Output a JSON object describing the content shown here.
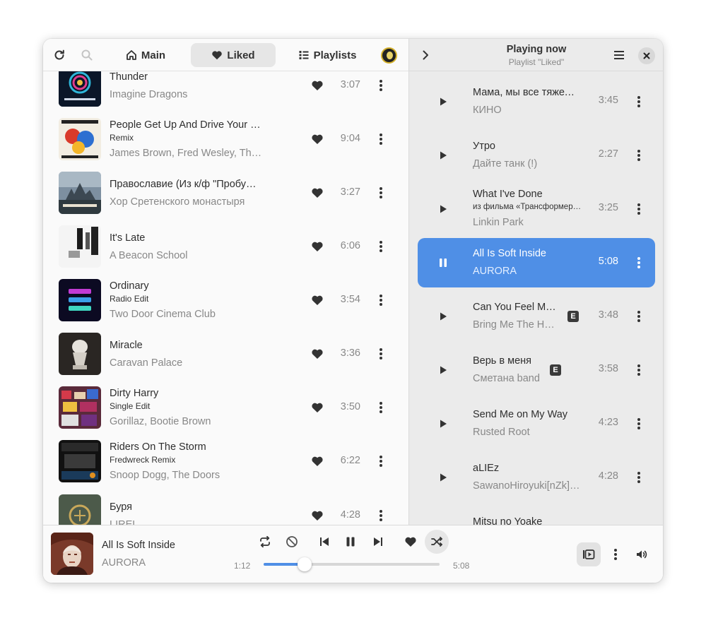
{
  "tabs": {
    "main": "Main",
    "liked": "Liked",
    "playlists": "Playlists"
  },
  "library": [
    {
      "title": "Thunder",
      "subtitle": "",
      "artist": "Imagine Dragons",
      "duration": "3:07"
    },
    {
      "title": "People Get Up And Drive Your …",
      "subtitle": "Remix",
      "artist": "James Brown, Fred Wesley, Th…",
      "duration": "9:04"
    },
    {
      "title": "Православие (Из к/ф \"Пробу…",
      "subtitle": "",
      "artist": "Хор Сретенского монастыря",
      "duration": "3:27"
    },
    {
      "title": "It's Late",
      "subtitle": "",
      "artist": "A Beacon School",
      "duration": "6:06"
    },
    {
      "title": "Ordinary",
      "subtitle": "Radio Edit",
      "artist": "Two Door Cinema Club",
      "duration": "3:54"
    },
    {
      "title": "Miracle",
      "subtitle": "",
      "artist": "Caravan Palace",
      "duration": "3:36"
    },
    {
      "title": "Dirty Harry",
      "subtitle": "Single Edit",
      "artist": "Gorillaz, Bootie Brown",
      "duration": "3:50"
    },
    {
      "title": "Riders On The Storm",
      "subtitle": "Fredwreck Remix",
      "artist": "Snoop Dogg, The Doors",
      "duration": "6:22"
    },
    {
      "title": "Буря",
      "subtitle": "",
      "artist": "LIREL",
      "duration": "4:28"
    }
  ],
  "queue_header": {
    "title": "Playing now",
    "subtitle": "Playlist \"Liked\""
  },
  "queue": [
    {
      "title": "Мама, мы все тяжел…",
      "subtitle": "",
      "artist": "КИНО",
      "duration": "3:45",
      "explicit": false,
      "playing": false
    },
    {
      "title": "Утро",
      "subtitle": "",
      "artist": "Дайте танк (!)",
      "duration": "2:27",
      "explicit": false,
      "playing": false
    },
    {
      "title": "What I've Done",
      "subtitle": "из фильма «Трансформер…",
      "artist": "Linkin Park",
      "duration": "3:25",
      "explicit": false,
      "playing": false
    },
    {
      "title": "All Is Soft Inside",
      "subtitle": "",
      "artist": "AURORA",
      "duration": "5:08",
      "explicit": false,
      "playing": true
    },
    {
      "title": "Can You Feel M…",
      "subtitle": "",
      "artist": "Bring Me The H…",
      "duration": "3:48",
      "explicit": true,
      "playing": false
    },
    {
      "title": "Верь в меня",
      "subtitle": "",
      "artist": "Сметана band",
      "duration": "3:58",
      "explicit": true,
      "playing": false
    },
    {
      "title": "Send Me on My Way",
      "subtitle": "",
      "artist": "Rusted Root",
      "duration": "4:23",
      "explicit": false,
      "playing": false
    },
    {
      "title": "aLIEz",
      "subtitle": "",
      "artist": "SawanoHiroyuki[nZk]…",
      "duration": "4:28",
      "explicit": false,
      "playing": false
    },
    {
      "title": "Mitsu no Yoake",
      "subtitle": "",
      "artist": "",
      "duration": "",
      "explicit": false,
      "playing": false
    }
  ],
  "explicit_badge": "E",
  "player": {
    "title": "All Is Soft Inside",
    "artist": "AURORA",
    "elapsed": "1:12",
    "total": "5:08",
    "progress_fraction": 0.234
  },
  "colors": {
    "accent": "#4f8fe6",
    "background": "#fafafa",
    "sidebar": "#ebebeb"
  }
}
